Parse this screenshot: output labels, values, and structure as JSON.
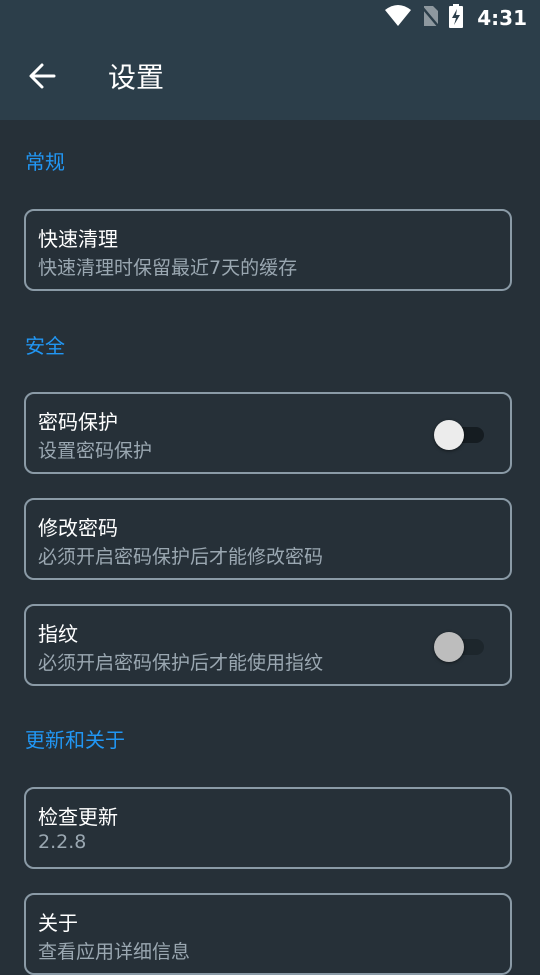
{
  "status_bar": {
    "time": "4:31",
    "icons": [
      "wifi-icon",
      "no-sim-icon",
      "battery-charging-icon"
    ]
  },
  "app_bar": {
    "back_icon": "arrow-left-icon",
    "title": "设置"
  },
  "sections": {
    "general": {
      "header": "常规",
      "quick_clean": {
        "title": "快速清理",
        "subtitle": "快速清理时保留最近7天的缓存"
      }
    },
    "security": {
      "header": "安全",
      "password_protect": {
        "title": "密码保护",
        "subtitle": "设置密码保护",
        "switch_on": false
      },
      "change_password": {
        "title": "修改密码",
        "subtitle": "必须开启密码保护后才能修改密码"
      },
      "fingerprint": {
        "title": "指纹",
        "subtitle": "必须开启密码保护后才能使用指纹",
        "switch_on": false,
        "switch_enabled": false
      }
    },
    "update_about": {
      "header": "更新和关于",
      "check_update": {
        "title": "检查更新",
        "subtitle": "2.2.8"
      },
      "about": {
        "title": "关于",
        "subtitle": "查看应用详细信息"
      }
    }
  },
  "colors": {
    "background": "#263038",
    "app_bar": "#2c3e4a",
    "accent": "#2196f3",
    "card_border": "#8a9aa6",
    "subtitle": "#9aa7b1"
  }
}
